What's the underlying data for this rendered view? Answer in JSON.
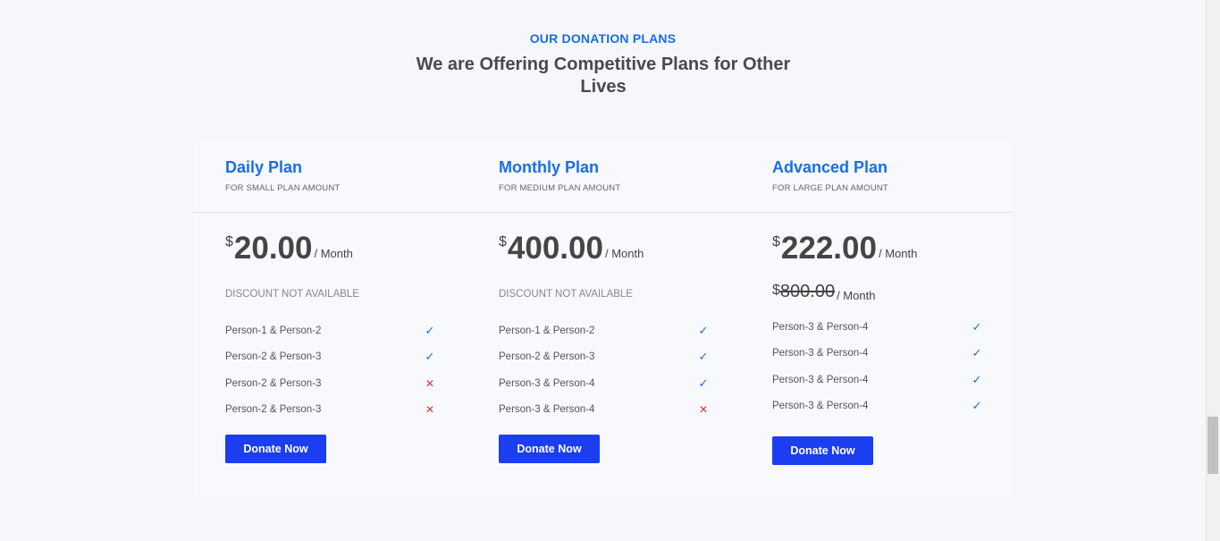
{
  "section": {
    "eyebrow": "OUR DONATION PLANS",
    "headline": "We are Offering Competitive Plans for Other Lives"
  },
  "plans": [
    {
      "title": "Daily Plan",
      "subtitle": "FOR SMALL PLAN AMOUNT",
      "currency": "$",
      "amount": "20.00",
      "period": "/ Month",
      "discount": "DISCOUNT NOT AVAILABLE",
      "features": [
        {
          "label": "Person-1 & Person-2",
          "included": true
        },
        {
          "label": "Person-2 & Person-3",
          "included": true
        },
        {
          "label": "Person-2 & Person-3",
          "included": false
        },
        {
          "label": "Person-2 & Person-3",
          "included": false
        }
      ],
      "button": "Donate Now"
    },
    {
      "title": "Monthly Plan",
      "subtitle": "FOR MEDIUM PLAN AMOUNT",
      "currency": "$",
      "amount": "400.00",
      "period": "/ Month",
      "discount": "DISCOUNT NOT AVAILABLE",
      "features": [
        {
          "label": "Person-1 & Person-2",
          "included": true
        },
        {
          "label": "Person-2 & Person-3",
          "included": true
        },
        {
          "label": "Person-3 & Person-4",
          "included": true
        },
        {
          "label": "Person-3 & Person-4",
          "included": false
        }
      ],
      "button": "Donate Now"
    },
    {
      "title": "Advanced Plan",
      "subtitle": "FOR LARGE PLAN AMOUNT",
      "currency": "$",
      "amount": "222.00",
      "period": "/ Month",
      "old_currency": "$",
      "old_amount": "800.00",
      "old_period": "/ Month",
      "features": [
        {
          "label": "Person-3 & Person-4",
          "included": true
        },
        {
          "label": "Person-3 & Person-4",
          "included": true
        },
        {
          "label": "Person-3 & Person-4",
          "included": true
        },
        {
          "label": "Person-3 & Person-4",
          "included": true
        }
      ],
      "button": "Donate Now"
    }
  ],
  "icons": {
    "included": "check-icon",
    "excluded": "cross-icon"
  },
  "colors": {
    "accent": "#1a6ee8",
    "button": "#1a3ef0",
    "cross": "#e0313b",
    "background": "#f5f7fb"
  }
}
